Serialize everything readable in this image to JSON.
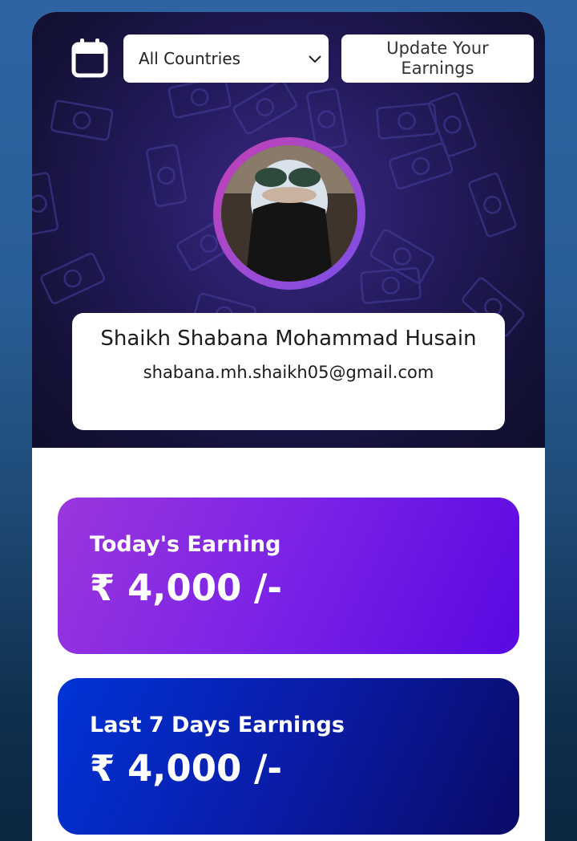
{
  "header": {
    "calendar_icon": "calendar-icon",
    "country_select": {
      "selected": "All Countries",
      "icon": "chevron-down-icon"
    },
    "update_button_label": "Update Your Earnings"
  },
  "profile": {
    "name": "Shaikh Shabana Mohammad Husain",
    "email": "shabana.mh.shaikh05@gmail.com",
    "avatar_icon": "avatar"
  },
  "earnings": {
    "today": {
      "label": "Today's Earning",
      "amount": "₹ 4,000 /-"
    },
    "last7": {
      "label": "Last 7 Days Earnings",
      "amount": "₹ 4,000 /-"
    }
  },
  "colors": {
    "hero_bg": "#1c1648",
    "today_card_start": "#9a36dd",
    "today_card_end": "#5a08e2",
    "week_card_start": "#0033d6",
    "week_card_end": "#0a0a66",
    "avatar_ring": "#b044c8"
  }
}
